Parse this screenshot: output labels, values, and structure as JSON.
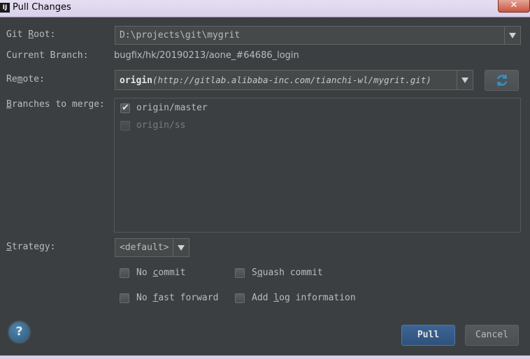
{
  "window": {
    "title": "Pull Changes",
    "app_icon_text": "IJ",
    "close_glyph": "✕"
  },
  "git_root": {
    "label_pre": "Git ",
    "label_mnemonic": "R",
    "label_post": "oot:",
    "value": "D:\\projects\\git\\mygrit"
  },
  "current_branch": {
    "label": "Current Branch:",
    "value": "bugfix/hk/20190213/aone_#64686_login"
  },
  "remote": {
    "label_pre": "Re",
    "label_mnemonic": "m",
    "label_post": "ote:",
    "name": "origin",
    "url": "(http://gitlab.alibaba-inc.com/tianchi-wl/mygrit.git)",
    "refresh_icon": "refresh-icon"
  },
  "branches": {
    "label_mnemonic": "B",
    "label_post": "ranches to merge:",
    "items": [
      {
        "label": "origin/master",
        "checked": true,
        "enabled": true
      },
      {
        "label": "origin/ss",
        "checked": false,
        "enabled": false
      }
    ]
  },
  "strategy": {
    "label_mnemonic": "S",
    "label_post": "trategy:",
    "value": "<default>"
  },
  "options": {
    "no_commit": {
      "pre": "No ",
      "mnemonic": "c",
      "post": "ommit",
      "checked": false
    },
    "squash_commit": {
      "pre": "S",
      "mnemonic": "q",
      "post": "uash commit",
      "checked": false
    },
    "no_fast_forward": {
      "pre": "No ",
      "mnemonic": "f",
      "post": "ast forward",
      "checked": false
    },
    "add_log": {
      "pre": "Add ",
      "mnemonic": "l",
      "post": "og information",
      "checked": false
    }
  },
  "help": {
    "glyph": "?"
  },
  "buttons": {
    "pull": "Pull",
    "cancel": "Cancel"
  },
  "colors": {
    "background": "#3c3f41",
    "text": "#bbbbbb",
    "accent_button": "#365880",
    "refresh_icon": "#3592c4",
    "help_icon": "#3d6a8c"
  }
}
